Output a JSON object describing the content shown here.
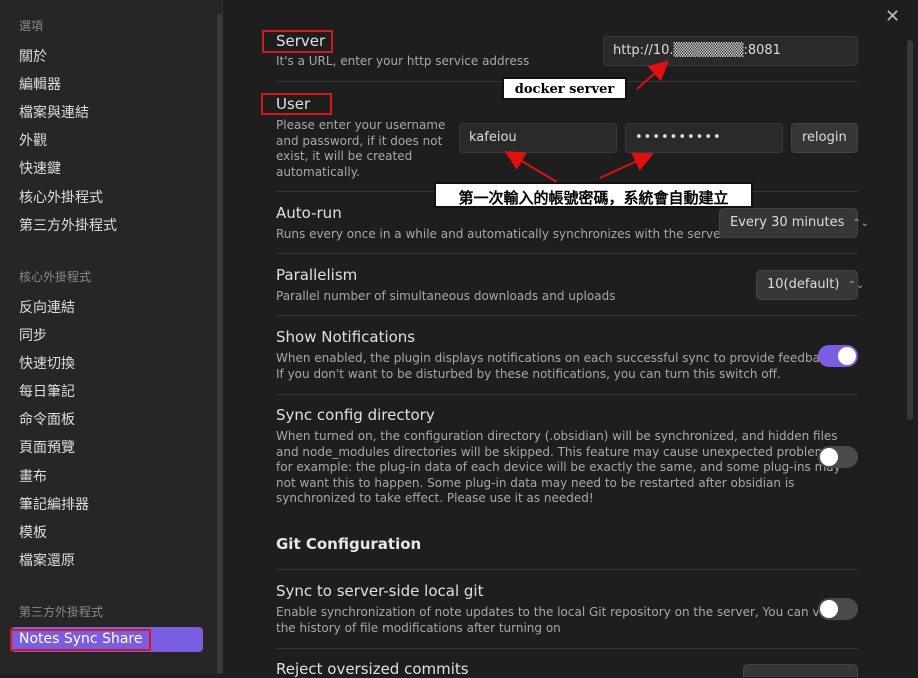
{
  "sidebar": {
    "sections": [
      {
        "label": "選項",
        "items": [
          "關於",
          "編輯器",
          "檔案與連結",
          "外觀",
          "快速鍵",
          "核心外掛程式",
          "第三方外掛程式"
        ]
      },
      {
        "label": "核心外掛程式",
        "items": [
          "反向連結",
          "同步",
          "快速切換",
          "每日筆記",
          "命令面板",
          "頁面預覽",
          "畫布",
          "筆記編排器",
          "模板",
          "檔案還原"
        ]
      },
      {
        "label": "第三方外掛程式",
        "items": [
          "Notes Sync Share"
        ]
      }
    ]
  },
  "settings": {
    "server": {
      "title": "Server",
      "desc": "It's a URL, enter your http service address",
      "value": "http://10.▒▒▒▒▒▒▒:8081"
    },
    "user": {
      "title": "User",
      "desc": [
        "Please enter your username",
        "and password, if it does not",
        "exist, it will be created",
        "automatically."
      ],
      "username": "kafeiou",
      "password": "••••••••••",
      "button": "relogin"
    },
    "autorun": {
      "title": "Auto-run",
      "desc": "Runs every once in a while and automatically synchronizes with the server",
      "value": "Every 30 minutes"
    },
    "parallelism": {
      "title": "Parallelism",
      "desc": "Parallel number of simultaneous downloads and uploads",
      "value": "10(default)"
    },
    "notifications": {
      "title": "Show Notifications",
      "desc": [
        "When enabled, the plugin displays notifications on each successful sync to provide feedback.",
        "If you don't want to be disturbed by these notifications, you can turn this switch off."
      ],
      "enabled": true
    },
    "syncconfig": {
      "title": "Sync config directory",
      "desc": [
        "When turned on, the configuration directory (.obsidian) will be synchronized, and hidden files",
        "and node_modules directories will be skipped. This feature may cause unexpected problems,",
        "for example: the plug-in data of each device will be exactly the same, and some plug-ins may",
        "not want this to happen. Some plug-in data may need to be restarted after obsidian is",
        "synchronized to take effect. Please use it as needed!"
      ],
      "enabled": false
    },
    "git_heading": "Git Configuration",
    "gitsync": {
      "title": "Sync to server-side local git",
      "desc": [
        "Enable synchronization of note updates to the local Git repository on the server, You can view",
        "the history of file modifications after turning on"
      ],
      "enabled": false
    },
    "reject": {
      "title": "Reject oversized commits"
    }
  },
  "annotations": {
    "docker": "docker server",
    "first_login": "第一次輸入的帳號密碼，系統會自動建立"
  },
  "colors": {
    "accent": "#7c5ce0",
    "annotation_red": "#d21a1a"
  }
}
